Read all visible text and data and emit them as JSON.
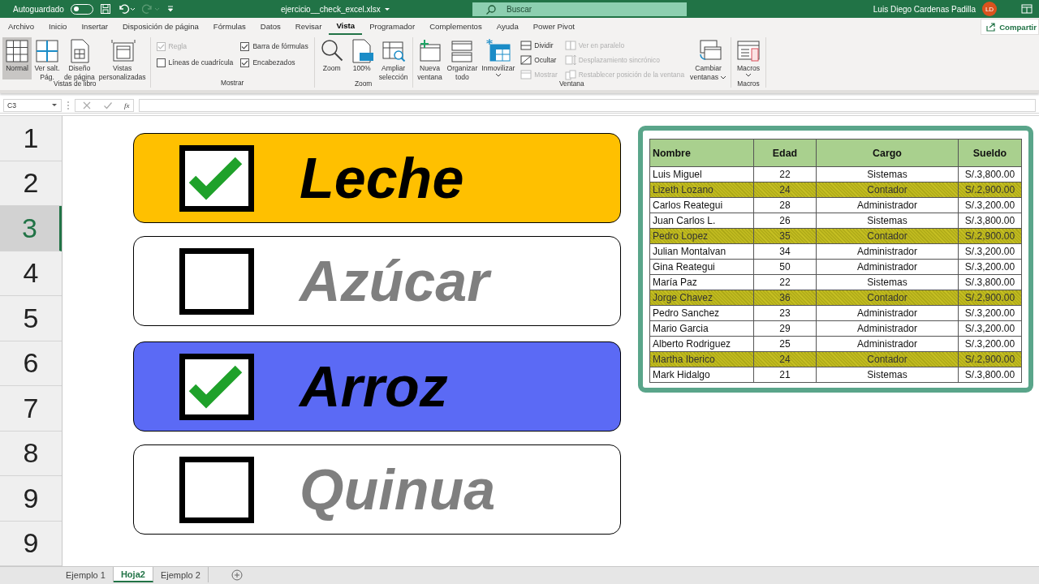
{
  "title_bar": {
    "autosave_label": "Autoguardado",
    "autosave_on": false,
    "filename": "ejercicio__check_excel.xlsx",
    "search_placeholder": "Buscar",
    "user_name": "Luis Diego Cardenas Padilla",
    "user_initials": "LD"
  },
  "ribbon_tabs": [
    {
      "label": "Archivo",
      "selected": false
    },
    {
      "label": "Inicio",
      "selected": false
    },
    {
      "label": "Insertar",
      "selected": false
    },
    {
      "label": "Disposición de página",
      "selected": false
    },
    {
      "label": "Fórmulas",
      "selected": false
    },
    {
      "label": "Datos",
      "selected": false
    },
    {
      "label": "Revisar",
      "selected": false
    },
    {
      "label": "Vista",
      "selected": true
    },
    {
      "label": "Programador",
      "selected": false
    },
    {
      "label": "Complementos",
      "selected": false
    },
    {
      "label": "Ayuda",
      "selected": false
    },
    {
      "label": "Power Pivot",
      "selected": false
    }
  ],
  "share_button": "Compartir",
  "ribbon_groups": [
    {
      "label": "Vistas de libro",
      "columns": [
        [
          {
            "kind": "large",
            "label": "Normal",
            "selected": true
          }
        ],
        [
          {
            "kind": "large",
            "label": "Ver salt.\nPág.",
            "selected": false
          }
        ],
        [
          {
            "kind": "large",
            "label": "Diseño\nde página",
            "selected": false
          }
        ],
        [
          {
            "kind": "large",
            "label": "Vistas\npersonalizadas",
            "selected": false
          }
        ]
      ]
    },
    {
      "label": "Mostrar",
      "columns": [
        [
          {
            "kind": "check",
            "label": "Regla",
            "checked": true,
            "disabled": true
          },
          {
            "kind": "check",
            "label": "Líneas de cuadrícula",
            "checked": false,
            "disabled": false
          }
        ],
        [
          {
            "kind": "check",
            "label": "Barra de fórmulas",
            "checked": true,
            "disabled": false
          },
          {
            "kind": "check",
            "label": "Encabezados",
            "checked": true,
            "disabled": false
          }
        ]
      ]
    },
    {
      "label": "Zoom",
      "columns": [
        [
          {
            "kind": "large",
            "label": "Zoom",
            "selected": false
          }
        ],
        [
          {
            "kind": "large",
            "label": "100%",
            "selected": false
          }
        ],
        [
          {
            "kind": "large",
            "label": "Ampliar\nselección",
            "selected": false
          }
        ]
      ]
    },
    {
      "label": "Ventana",
      "columns": [
        [
          {
            "kind": "large",
            "label": "Nueva\nventana",
            "selected": false
          }
        ],
        [
          {
            "kind": "large",
            "label": "Organizar\ntodo",
            "selected": false
          }
        ],
        [
          {
            "kind": "large",
            "label": "Inmovilizar",
            "selected": false,
            "dropdown": true
          }
        ],
        [
          {
            "kind": "small",
            "label": "Dividir",
            "disabled": false
          },
          {
            "kind": "small",
            "label": "Ocultar",
            "disabled": false
          },
          {
            "kind": "small",
            "label": "Mostrar",
            "disabled": true
          }
        ],
        [
          {
            "kind": "small",
            "label": "Ver en paralelo",
            "disabled": true
          },
          {
            "kind": "small",
            "label": "Desplazamiento sincrónico",
            "disabled": true
          },
          {
            "kind": "small",
            "label": "Restablecer posición de la ventana",
            "disabled": true
          }
        ],
        [
          {
            "kind": "large",
            "label": "Cambiar\nventanas",
            "selected": false,
            "dropdown": true
          }
        ]
      ]
    },
    {
      "label": "Macros",
      "columns": [
        [
          {
            "kind": "large",
            "label": "Macros",
            "selected": false,
            "dropdown": true
          }
        ]
      ]
    }
  ],
  "formula_bar": {
    "name_box": "C3",
    "fx": "fx"
  },
  "row_headers": [
    {
      "label": "1",
      "selected": false
    },
    {
      "label": "2",
      "selected": false
    },
    {
      "label": "3",
      "selected": true
    },
    {
      "label": "4",
      "selected": false
    },
    {
      "label": "5",
      "selected": false
    },
    {
      "label": "6",
      "selected": false
    },
    {
      "label": "7",
      "selected": false
    },
    {
      "label": "8",
      "selected": false
    },
    {
      "label": "9",
      "selected": false
    },
    {
      "label": "9",
      "selected": false
    }
  ],
  "checklist": [
    {
      "label": "Leche",
      "checked": true,
      "color": "#ffc000"
    },
    {
      "label": "Azúcar",
      "checked": false,
      "color": "#ffffff"
    },
    {
      "label": "Arroz",
      "checked": true,
      "color": "#5b6af5"
    },
    {
      "label": "Quinua",
      "checked": false,
      "color": "#ffffff"
    }
  ],
  "table": {
    "columns": [
      "Nombre",
      "Edad",
      "Cargo",
      "Sueldo"
    ],
    "rows": [
      {
        "cells": [
          "Luis Miguel",
          "22",
          "Sistemas",
          "S/.3,800.00"
        ],
        "highlighted": false
      },
      {
        "cells": [
          "Lizeth Lozano",
          "24",
          "Contador",
          "S/.2,900.00"
        ],
        "highlighted": true
      },
      {
        "cells": [
          "Carlos Reategui",
          "28",
          "Administrador",
          "S/.3,200.00"
        ],
        "highlighted": false
      },
      {
        "cells": [
          "Juan Carlos L.",
          "26",
          "Sistemas",
          "S/.3,800.00"
        ],
        "highlighted": false
      },
      {
        "cells": [
          "Pedro Lopez",
          "35",
          "Contador",
          "S/.2,900.00"
        ],
        "highlighted": true
      },
      {
        "cells": [
          "Julian Montalvan",
          "34",
          "Administrador",
          "S/.3,200.00"
        ],
        "highlighted": false
      },
      {
        "cells": [
          "Gina Reategui",
          "50",
          "Administrador",
          "S/.3,200.00"
        ],
        "highlighted": false
      },
      {
        "cells": [
          "María Paz",
          "22",
          "Sistemas",
          "S/.3,800.00"
        ],
        "highlighted": false
      },
      {
        "cells": [
          "Jorge Chavez",
          "36",
          "Contador",
          "S/.2,900.00"
        ],
        "highlighted": true
      },
      {
        "cells": [
          "Pedro Sanchez",
          "23",
          "Administrador",
          "S/.3,200.00"
        ],
        "highlighted": false
      },
      {
        "cells": [
          "Mario Garcia",
          "29",
          "Administrador",
          "S/.3,200.00"
        ],
        "highlighted": false
      },
      {
        "cells": [
          "Alberto Rodriguez",
          "25",
          "Administrador",
          "S/.3,200.00"
        ],
        "highlighted": false
      },
      {
        "cells": [
          "Martha Iberico",
          "24",
          "Contador",
          "S/.2,900.00"
        ],
        "highlighted": true
      },
      {
        "cells": [
          "Mark Hidalgo",
          "21",
          "Sistemas",
          "S/.3,800.00"
        ],
        "highlighted": false
      }
    ]
  },
  "sheet_tabs": [
    {
      "label": "Ejemplo 1",
      "selected": false
    },
    {
      "label": "Hoja2",
      "selected": true
    },
    {
      "label": "Ejemplo 2",
      "selected": false
    }
  ]
}
